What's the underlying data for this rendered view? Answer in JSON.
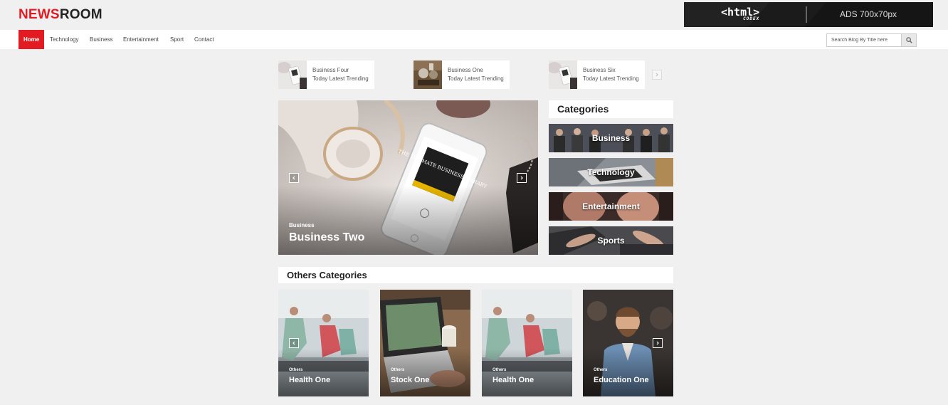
{
  "logo": {
    "part1": "NEWS",
    "part2": "ROOM"
  },
  "ad": {
    "brand": "<html>",
    "brand_sub": "CODEX",
    "size_text": "ADS 700x70px"
  },
  "nav": {
    "items": [
      "Home",
      "Technology",
      "Business",
      "Entertainment",
      "Sport",
      "Contact"
    ],
    "search_placeholder": "Search Blog By Title here"
  },
  "trending": [
    {
      "title": "Business Four",
      "subtitle": "Today Latest Trending"
    },
    {
      "title": "Business One",
      "subtitle": "Today Latest Trending"
    },
    {
      "title": "Business Six",
      "subtitle": "Today Latest Trending"
    }
  ],
  "hero": {
    "category": "Business",
    "title": "Business Two",
    "book_text": "THE ULTIMATE BUSINESS LIBRARY"
  },
  "categories": {
    "heading": "Categories",
    "items": [
      "Business",
      "Technology",
      "Entertainment",
      "Sports"
    ]
  },
  "others": {
    "heading": "Others Categories",
    "cards": [
      {
        "category": "Others",
        "title": "Health One"
      },
      {
        "category": "Others",
        "title": "Stock One"
      },
      {
        "category": "Others",
        "title": "Health One"
      },
      {
        "category": "Others",
        "title": "Education One"
      }
    ]
  },
  "colors": {
    "accent": "#e21b22",
    "background": "#f0f0f0"
  },
  "icons": {
    "search": "search-icon",
    "prev": "chevron-left-icon",
    "next": "chevron-right-icon"
  }
}
